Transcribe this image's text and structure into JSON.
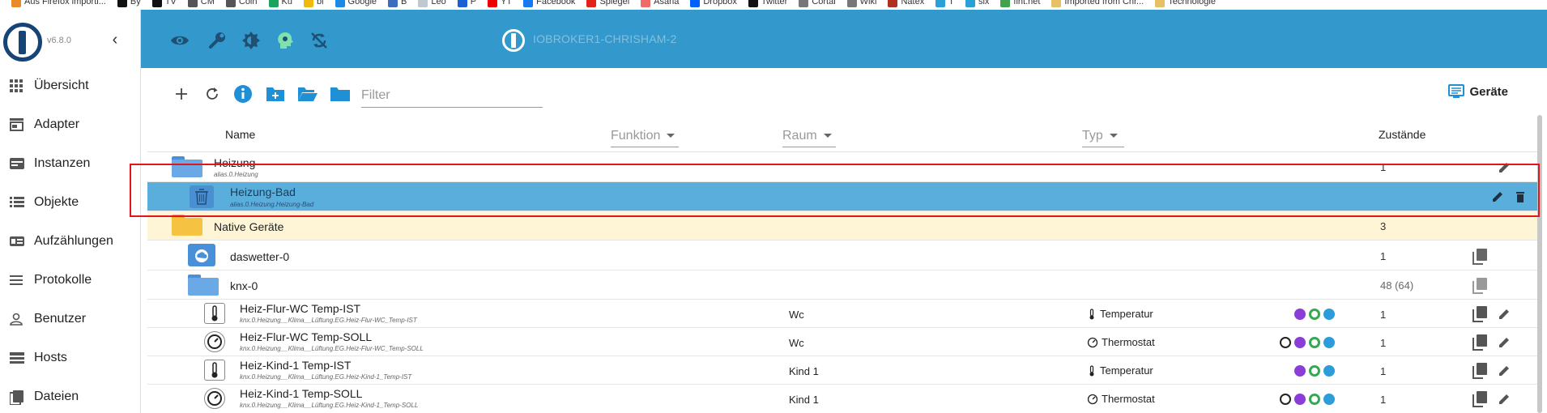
{
  "bookmarks": [
    {
      "label": "Aus Firefox importi...",
      "color": "#e8892a"
    },
    {
      "label": "By",
      "color": "#111"
    },
    {
      "label": "TV",
      "color": "#111"
    },
    {
      "label": "CM",
      "color": "#555"
    },
    {
      "label": "Coin",
      "color": "#555"
    },
    {
      "label": "Ku",
      "color": "#1aa35a"
    },
    {
      "label": "bi",
      "color": "#f0b90b"
    },
    {
      "label": "Google",
      "color": "#1e88e5"
    },
    {
      "label": "B",
      "color": "#3b6dbf"
    },
    {
      "label": "Leo",
      "color": "#c0c8d0"
    },
    {
      "label": "P",
      "color": "#1b5fd6"
    },
    {
      "label": "YT",
      "color": "#e00"
    },
    {
      "label": "Facebook",
      "color": "#1877f2"
    },
    {
      "label": "Spiegel",
      "color": "#e2231a"
    },
    {
      "label": "Asana",
      "color": "#f06a6a"
    },
    {
      "label": "Dropbox",
      "color": "#0061fe"
    },
    {
      "label": "Twitter",
      "color": "#111"
    },
    {
      "label": "Cortal",
      "color": "#777"
    },
    {
      "label": "Wiki",
      "color": "#777"
    },
    {
      "label": "Natex",
      "color": "#b03020"
    },
    {
      "label": "T",
      "color": "#2aa0d8"
    },
    {
      "label": "six",
      "color": "#2aa0d8"
    },
    {
      "label": "fint.net",
      "color": "#3fa34d"
    },
    {
      "label": "Imported from Chr...",
      "color": "#e8c068"
    },
    {
      "label": "Technologie",
      "color": "#e8c068"
    }
  ],
  "sidebar": {
    "version": "v6.8.0",
    "items": [
      {
        "label": "Übersicht",
        "icon": "grid-icon"
      },
      {
        "label": "Adapter",
        "icon": "store-icon"
      },
      {
        "label": "Instanzen",
        "icon": "instances-icon"
      },
      {
        "label": "Objekte",
        "icon": "list-icon"
      },
      {
        "label": "Aufzählungen",
        "icon": "enum-icon"
      },
      {
        "label": "Protokolle",
        "icon": "log-icon"
      },
      {
        "label": "Benutzer",
        "icon": "user-icon"
      },
      {
        "label": "Hosts",
        "icon": "hosts-icon"
      },
      {
        "label": "Dateien",
        "icon": "files-icon"
      }
    ]
  },
  "header": {
    "host": "IOBROKER1-CHRISHAM-2"
  },
  "toolbar": {
    "filter_placeholder": "Filter",
    "devices_label": "Geräte"
  },
  "table": {
    "headers": {
      "name": "Name",
      "funktion": "Funktion",
      "raum": "Raum",
      "typ": "Typ",
      "zustaende": "Zustände"
    },
    "rows": [
      {
        "name": "Heizung",
        "id": "alias.0.Heizung",
        "states": "1"
      },
      {
        "name": "Heizung-Bad",
        "id": "alias.0.Heizung.Heizung-Bad"
      },
      {
        "name": "Native Geräte",
        "states": "3"
      },
      {
        "name": "daswetter-0",
        "states": "1"
      },
      {
        "name": "knx-0",
        "states": "48 (64)"
      },
      {
        "name": "Heiz-Flur-WC Temp-IST",
        "id": "knx.0.Heizung__Klima__Lüftung.EG.Heiz-Flur-WC_Temp-IST",
        "room": "Wc",
        "type": "Temperatur",
        "states": "1"
      },
      {
        "name": "Heiz-Flur-WC Temp-SOLL",
        "id": "knx.0.Heizung__Klima__Lüftung.EG.Heiz-Flur-WC_Temp-SOLL",
        "room": "Wc",
        "type": "Thermostat",
        "states": "1"
      },
      {
        "name": "Heiz-Kind-1 Temp-IST",
        "id": "knx.0.Heizung__Klima__Lüftung.EG.Heiz-Kind-1_Temp-IST",
        "room": "Kind 1",
        "type": "Temperatur",
        "states": "1"
      },
      {
        "name": "Heiz-Kind-1 Temp-SOLL",
        "id": "knx.0.Heizung__Klima__Lüftung.EG.Heiz-Kind-1_Temp-SOLL",
        "room": "Kind 1",
        "type": "Thermostat",
        "states": "1"
      }
    ]
  },
  "colors": {
    "header": "#3399cc",
    "selected": "#5aaedb",
    "native_bg": "#fdf5d6",
    "folder_blue": "#4a90d9",
    "folder_yellow": "#f5c242"
  }
}
